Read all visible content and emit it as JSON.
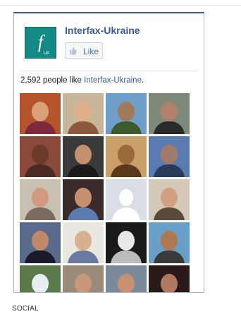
{
  "page": {
    "name": "Interfax-Ukraine",
    "like_label": "Like",
    "logo_letter": "f",
    "logo_sub": "UA"
  },
  "likes": {
    "count_text": "2,592 people like ",
    "page_link": "Interfax-Ukraine",
    "suffix": "."
  },
  "colors": {
    "brand_blue": "#3b5998",
    "logo_teal": "#148a84"
  },
  "faces": [
    {
      "name": "fan-1",
      "bg": "#b5532c",
      "skin": "#d9a07a",
      "shirt": "#7a2a3a"
    },
    {
      "name": "fan-2",
      "bg": "#c9b59a",
      "skin": "#e0b08a",
      "shirt": "#8c5a3a"
    },
    {
      "name": "fan-3",
      "bg": "#6f9fc9",
      "skin": "#a07a5a",
      "shirt": "#3c5a2a"
    },
    {
      "name": "fan-4",
      "bg": "#7d8a7a",
      "skin": "#b08068",
      "shirt": "#2a2a2a"
    },
    {
      "name": "fan-5",
      "bg": "#8a4a3a",
      "skin": "#6a3a2a",
      "shirt": "#4a2a22"
    },
    {
      "name": "fan-6",
      "bg": "#3a3a3a",
      "skin": "#c49070",
      "shirt": "#1a1a1a"
    },
    {
      "name": "fan-7",
      "bg": "#c9a06a",
      "skin": "#9a6a3a",
      "shirt": "#5a3a1a"
    },
    {
      "name": "fan-8",
      "bg": "#5a7ab0",
      "skin": "#a07a6a",
      "shirt": "#2a3a5a"
    },
    {
      "name": "fan-9",
      "bg": "#c8c0b0",
      "skin": "#d49a80",
      "shirt": "#7a6a60"
    },
    {
      "name": "fan-10",
      "bg": "#3a2a2a",
      "skin": "#c49070",
      "shirt": "#5a7ab0"
    },
    {
      "name": "fan-11",
      "bg": "#d8dde6",
      "skin": "#ffffff",
      "shirt": "#ffffff",
      "silhouette": true
    },
    {
      "name": "fan-12",
      "bg": "#d4c8b8",
      "skin": "#d0a080",
      "shirt": "#5a4a3a"
    },
    {
      "name": "fan-13",
      "bg": "#5a6a8a",
      "skin": "#c08a6a",
      "shirt": "#1a1a2a"
    },
    {
      "name": "fan-14",
      "bg": "#e8e8e0",
      "skin": "#d8b090",
      "shirt": "#6a7aa0"
    },
    {
      "name": "fan-15",
      "bg": "#1a1a1a",
      "skin": "#e8e8e8",
      "shirt": "#bbbbbb"
    },
    {
      "name": "fan-16",
      "bg": "#6aa0c8",
      "skin": "#b07850",
      "shirt": "#3a3a3a"
    },
    {
      "name": "fan-17",
      "bg": "#5a7a4a",
      "skin": "#e8eef0",
      "shirt": "#6a8a5a"
    },
    {
      "name": "fan-18",
      "bg": "#9a8a7a",
      "skin": "#c8987a",
      "shirt": "#3a2a2a"
    },
    {
      "name": "fan-19",
      "bg": "#7a8a9a",
      "skin": "#c89070",
      "shirt": "#2a2a2a"
    },
    {
      "name": "fan-20",
      "bg": "#2a1a1a",
      "skin": "#b07a60",
      "shirt": "#3a2a2a"
    }
  ],
  "footer": {
    "label": "SOCIAL"
  }
}
